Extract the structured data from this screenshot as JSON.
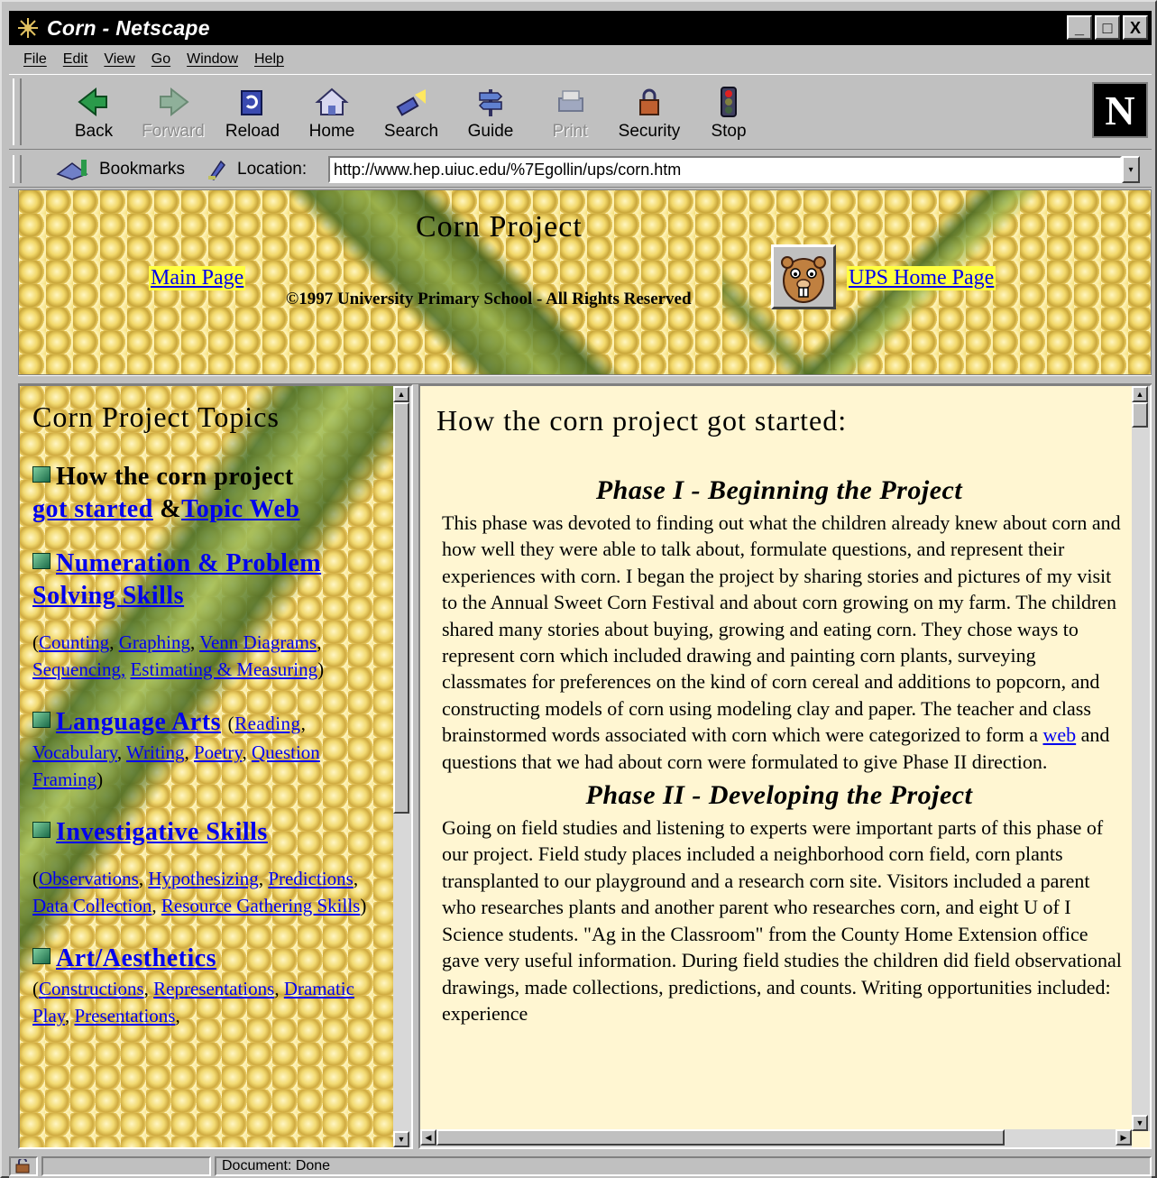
{
  "window": {
    "title": "Corn - Netscape",
    "controls": [
      "_",
      "□",
      "X"
    ]
  },
  "menu": [
    "File",
    "Edit",
    "View",
    "Go",
    "Window",
    "Help"
  ],
  "toolbar": {
    "buttons": [
      {
        "label": "Back",
        "icon": "back-arrow-icon",
        "enabled": true
      },
      {
        "label": "Forward",
        "icon": "forward-arrow-icon",
        "enabled": false
      },
      {
        "label": "Reload",
        "icon": "reload-icon",
        "enabled": true
      },
      {
        "label": "Home",
        "icon": "home-icon",
        "enabled": true
      },
      {
        "label": "Search",
        "icon": "search-flashlight-icon",
        "enabled": true
      },
      {
        "label": "Guide",
        "icon": "guide-signpost-icon",
        "enabled": true
      },
      {
        "label": "Print",
        "icon": "printer-icon",
        "enabled": false
      },
      {
        "label": "Security",
        "icon": "padlock-icon",
        "enabled": true
      },
      {
        "label": "Stop",
        "icon": "stop-traffic-light-icon",
        "enabled": true
      }
    ]
  },
  "location_bar": {
    "bookmarks_label": "Bookmarks",
    "location_label": "Location:",
    "url": "http://www.hep.uiuc.edu/%7Egollin/ups/corn.htm"
  },
  "banner": {
    "title": "Corn Project",
    "main_link": "Main Page",
    "copyright": "©1997 University Primary School - All Rights Reserved",
    "ups_link": "UPS Home Page"
  },
  "left": {
    "title": "Corn Project Topics",
    "topic1": {
      "text": "How the corn project",
      "link1": "got started",
      "amp": " &",
      "link2": "Topic Web"
    },
    "topic2": {
      "link": "Numeration & Problem Solving Skills"
    },
    "topic2_sub": {
      "open": "(",
      "items": [
        "Counting",
        "Graphing",
        "Venn Diagrams",
        "Sequencing,",
        "Estimating & Measuring"
      ],
      "close": ")"
    },
    "topic3": {
      "link": "Language Arts"
    },
    "topic3_sub": {
      "open": "(",
      "items": [
        "Reading",
        "Vocabulary",
        "Writing",
        "Poetry",
        "Question Framing"
      ],
      "close": ")"
    },
    "topic4": {
      "link": "Investigative Skills"
    },
    "topic4_sub": {
      "open": "(",
      "items": [
        "Observations",
        "Hypothesizing",
        "Predictions",
        "Data Collection",
        "Resource Gathering Skills"
      ],
      "close": ")"
    },
    "topic5": {
      "link": "Art/Aesthetics"
    },
    "topic5_sub": {
      "open": "(",
      "items": [
        "Constructions",
        "Representations",
        "Dramatic Play",
        "Presentations"
      ]
    }
  },
  "right": {
    "heading": "How the corn project got started:",
    "phase1_title": "Phase I - Beginning the Project",
    "phase1_before": "This phase was devoted to finding out what the children already knew about corn and how well they were able to talk about, formulate questions, and represent their experiences with corn. I began the project by sharing stories and pictures of my visit to the Annual Sweet Corn Festival and about corn growing on my farm. The children shared many stories about buying, growing and eating corn. They chose ways to represent corn which included drawing and painting corn plants, surveying classmates for preferences on the kind of corn cereal and additions to popcorn, and constructing models of corn using modeling clay and paper. The teacher and class brainstormed words associated with corn which were categorized to form a ",
    "phase1_link": "web",
    "phase1_after": " and questions that we had about corn were formulated to give Phase II direction.",
    "phase2_title": "Phase II - Developing the Project",
    "phase2_text": "Going on field studies and listening to experts were important parts of this phase of our project. Field study places included a neighborhood corn field, corn plants transplanted to our playground and a research corn site. Visitors included a parent who researches plants and another parent who researches corn, and eight U of I Science students. \"Ag in the Classroom\" from the County Home Extension office gave very useful information. During field studies the children did field observational drawings, made collections, predictions, and counts. Writing opportunities included: experience"
  },
  "status": {
    "text": "Document: Done"
  }
}
